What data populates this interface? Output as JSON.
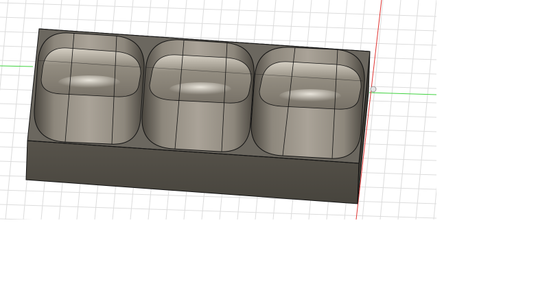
{
  "canvas": {
    "background": "#ffffff",
    "grid_line_color": "#dcdcdc",
    "x_axis_color": "#3fd23f",
    "y_axis_color": "#e0312f"
  },
  "model": {
    "type": "three-pocket-tray",
    "pocket_count": 3,
    "body_color": "#4f4b43",
    "top_face_color": "#6e6a62",
    "pocket_color": "#807a70",
    "edge_color": "#121212"
  },
  "icons": {
    "origin_marker": "origin-point-icon"
  }
}
